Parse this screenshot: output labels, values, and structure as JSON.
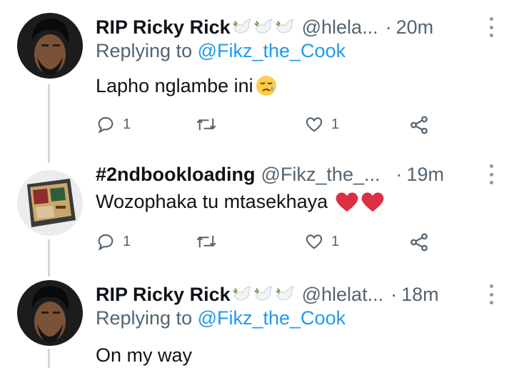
{
  "tweets": [
    {
      "name": "RIP Ricky Rick",
      "handle": "@hlela...",
      "dot": "·",
      "time": "20m",
      "replying_prefix": "Replying to ",
      "replying_to": "@Fikz_the_Cook",
      "text": "Lapho nglambe ini",
      "text_emoji": "sad-relieved-face",
      "name_emojis": [
        "dove-of-peace",
        "dove-of-peace",
        "dove-of-peace"
      ],
      "replies": "1",
      "retweets": "",
      "likes": "1"
    },
    {
      "name": "#2ndbookloading",
      "handle": "@Fikz_the_...",
      "dot": "·",
      "time": "19m",
      "text": "Wozophaka tu mtasekhaya",
      "text_emoji": "red-heart x2",
      "replies": "1",
      "retweets": "",
      "likes": "1"
    },
    {
      "name": "RIP Ricky Rick",
      "handle": "@hlelat...",
      "dot": "·",
      "time": "18m",
      "replying_prefix": "Replying to ",
      "replying_to": "@Fikz_the_Cook",
      "text": "On my way",
      "name_emojis": [
        "dove-of-peace",
        "dove-of-peace",
        "dove-of-peace"
      ]
    }
  ],
  "colors": {
    "text": "#0f1419",
    "secondary": "#536471",
    "link": "#1d9bf0",
    "thread_line": "#cfd9de",
    "heart": "#e0245e"
  }
}
